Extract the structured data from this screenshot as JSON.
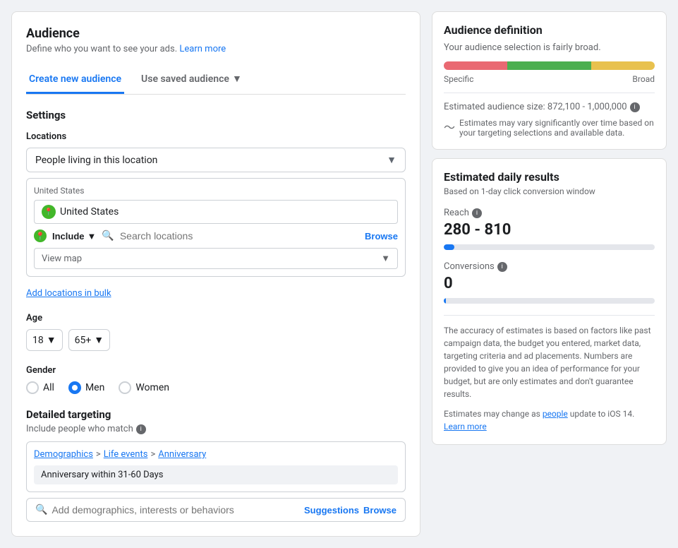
{
  "header": {
    "title": "Audience",
    "subtitle": "Define who you want to see your ads.",
    "learn_more": "Learn more"
  },
  "tabs": {
    "create": "Create new audience",
    "saved": "Use saved audience"
  },
  "settings": {
    "label": "Settings"
  },
  "locations": {
    "label": "Locations",
    "dropdown_value": "People living in this location",
    "country_header": "United States",
    "country_tag": "United States",
    "include_label": "Include",
    "search_placeholder": "Search locations",
    "browse_label": "Browse",
    "view_map": "View map",
    "add_bulk": "Add locations in bulk"
  },
  "age": {
    "label": "Age",
    "min": "18",
    "max": "65+"
  },
  "gender": {
    "label": "Gender",
    "options": [
      "All",
      "Men",
      "Women"
    ],
    "selected": "Men"
  },
  "detailed_targeting": {
    "title": "Detailed targeting",
    "subtitle": "Include people who match",
    "breadcrumbs": [
      "Demographics",
      "Life events",
      "Anniversary"
    ],
    "tag": "Anniversary within 31-60 Days",
    "search_placeholder": "Add demographics, interests or behaviors",
    "suggestions_label": "Suggestions",
    "browse_label": "Browse"
  },
  "audience_definition": {
    "title": "Audience definition",
    "subtitle": "Your audience selection is fairly broad.",
    "meter": {
      "segment1_color": "#e96972",
      "segment1_width": 30,
      "segment2_color": "#4caf50",
      "segment2_width": 40,
      "segment3_color": "#e8c14e",
      "segment3_width": 30
    },
    "label_specific": "Specific",
    "label_broad": "Broad",
    "size_label": "Estimated audience size: 872,100 - 1,000,000"
  },
  "estimated_results": {
    "title": "Estimated daily results",
    "subtitle": "Based on 1-day click conversion window",
    "reach_label": "Reach",
    "reach_value": "280 - 810",
    "conversions_label": "Conversions",
    "conversions_value": "0",
    "accuracy_note": "The accuracy of estimates is based on factors like past campaign data, the budget you entered, market data, targeting criteria and ad placements. Numbers are provided to give you an idea of performance for your budget, but are only estimates and don't guarantee results.",
    "ios_note": "Estimates may change as",
    "ios_link": "people",
    "ios_note2": "update to iOS 14.",
    "learn_more": "Learn more"
  }
}
